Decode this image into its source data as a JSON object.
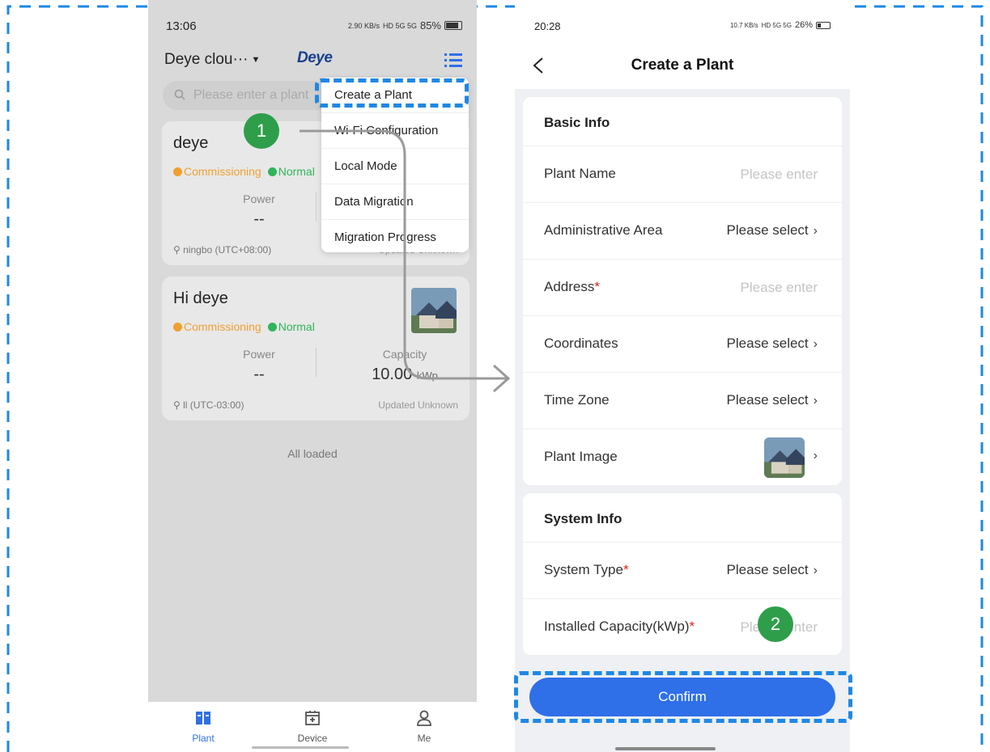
{
  "left_phone": {
    "status": {
      "time": "13:06",
      "speed": "2.90 KB/s",
      "network": "HD 5G 5G",
      "battery": "85%"
    },
    "header": {
      "account": "Deye clou···",
      "brand": "Deye"
    },
    "search": {
      "placeholder": "Please enter a plant"
    },
    "plants": [
      {
        "name": "deye",
        "status_commissioning": "Commissioning",
        "status_normal": "Normal",
        "power_label": "Power",
        "power_value": "--",
        "location": "ningbo  (UTC+08:00)",
        "updated": "Updated  Unknown"
      },
      {
        "name": "Hi deye",
        "status_commissioning": "Commissioning",
        "status_normal": "Normal",
        "power_label": "Power",
        "power_value": "--",
        "capacity_label": "Capacity",
        "capacity_value": "10.00",
        "capacity_unit": "kWp",
        "location": "ll (UTC-03:00)",
        "updated": "Updated  Unknown"
      }
    ],
    "all_loaded": "All loaded",
    "menu": [
      "Create a Plant",
      "Wi-Fi Configuration",
      "Local Mode",
      "Data Migration",
      "Migration Progress"
    ],
    "nav": {
      "plant": "Plant",
      "device": "Device",
      "me": "Me"
    }
  },
  "right_phone": {
    "status": {
      "time": "20:28",
      "speed": "10.7 KB/s",
      "network": "HD 5G 5G",
      "battery": "26%"
    },
    "title": "Create a Plant",
    "basic_info": {
      "title": "Basic Info",
      "plant_name_label": "Plant Name",
      "plant_name_placeholder": "Please enter",
      "admin_area_label": "Administrative Area",
      "admin_area_value": "Please select",
      "address_label": "Address",
      "address_placeholder": "Please enter",
      "coordinates_label": "Coordinates",
      "coordinates_value": "Please select",
      "time_zone_label": "Time Zone",
      "time_zone_value": "Please select",
      "plant_image_label": "Plant Image"
    },
    "system_info": {
      "title": "System Info",
      "system_type_label": "System Type",
      "system_type_value": "Please select",
      "installed_capacity_label": "Installed Capacity(kWp)",
      "installed_capacity_placeholder": "Please enter"
    },
    "confirm_label": "Confirm",
    "required_mark": "*"
  },
  "annotations": {
    "step1": "1",
    "step2": "2"
  },
  "colors": {
    "accent": "#2f6fe8",
    "badge": "#2f9e4a",
    "highlight": "#1e88e5",
    "commissioning": "#f0a030",
    "normal": "#2fb55a",
    "required": "#e02020"
  },
  "icons": [
    "search-icon",
    "menu-icon",
    "back-icon",
    "plant-nav-icon",
    "device-nav-icon",
    "me-nav-icon",
    "location-pin-icon",
    "chevron-right-icon"
  ]
}
